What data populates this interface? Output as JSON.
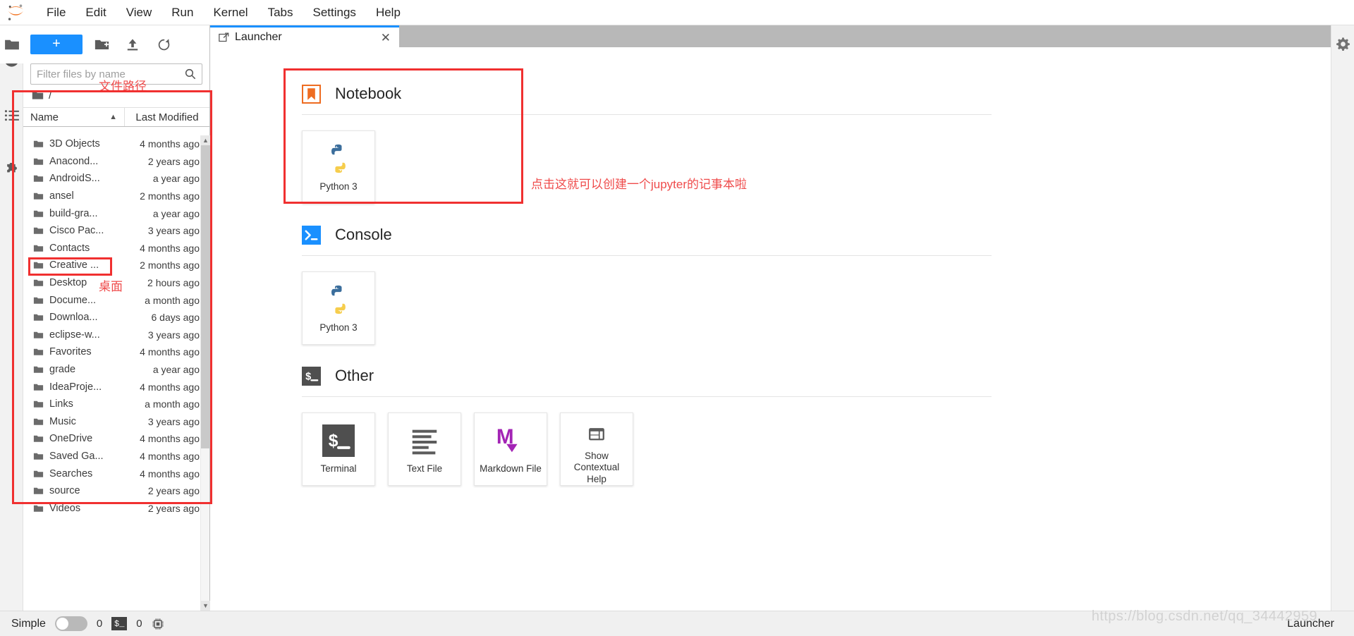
{
  "app": {
    "logo": "jupyter-logo",
    "menu": [
      "File",
      "Edit",
      "View",
      "Run",
      "Kernel",
      "Tabs",
      "Settings",
      "Help"
    ]
  },
  "left_rail": {
    "items": [
      {
        "name": "file-browser-icon",
        "glyph": "folder"
      },
      {
        "name": "running-terminals-icon",
        "glyph": "stop-circle"
      },
      {
        "name": "commands-icon",
        "glyph": "list"
      },
      {
        "name": "extension-manager-icon",
        "glyph": "puzzle"
      }
    ]
  },
  "right_rail": {
    "items": [
      {
        "name": "property-inspector-icon",
        "glyph": "gear"
      }
    ]
  },
  "file_browser": {
    "toolbar": {
      "new_launcher_label": "+",
      "new_folder_label": "new-folder-icon",
      "upload_label": "upload-icon",
      "refresh_label": "refresh-icon"
    },
    "filter": {
      "placeholder": "Filter files by name",
      "value": ""
    },
    "breadcrumb": "/",
    "columns": {
      "name": "Name",
      "last_modified": "Last Modified"
    },
    "sort_indicator": "▲",
    "rows": [
      {
        "name": "3D Objects",
        "modified": "4 months ago"
      },
      {
        "name": "Anacond...",
        "modified": "2 years ago"
      },
      {
        "name": "AndroidS...",
        "modified": "a year ago"
      },
      {
        "name": "ansel",
        "modified": "2 months ago"
      },
      {
        "name": "build-gra...",
        "modified": "a year ago"
      },
      {
        "name": "Cisco Pac...",
        "modified": "3 years ago"
      },
      {
        "name": "Contacts",
        "modified": "4 months ago"
      },
      {
        "name": "Creative ...",
        "modified": "2 months ago"
      },
      {
        "name": "Desktop",
        "modified": "2 hours ago"
      },
      {
        "name": "Docume...",
        "modified": "a month ago"
      },
      {
        "name": "Downloa...",
        "modified": "6 days ago"
      },
      {
        "name": "eclipse-w...",
        "modified": "3 years ago"
      },
      {
        "name": "Favorites",
        "modified": "4 months ago"
      },
      {
        "name": "grade",
        "modified": "a year ago"
      },
      {
        "name": "IdeaProje...",
        "modified": "4 months ago"
      },
      {
        "name": "Links",
        "modified": "a month ago"
      },
      {
        "name": "Music",
        "modified": "3 years ago"
      },
      {
        "name": "OneDrive",
        "modified": "4 months ago"
      },
      {
        "name": "Saved Ga...",
        "modified": "4 months ago"
      },
      {
        "name": "Searches",
        "modified": "4 months ago"
      },
      {
        "name": "source",
        "modified": "2 years ago"
      },
      {
        "name": "Videos",
        "modified": "2 years ago"
      }
    ]
  },
  "main": {
    "tab": {
      "title": "Launcher",
      "close": "✕"
    },
    "launcher": {
      "sections": [
        {
          "id": "notebook",
          "title": "Notebook",
          "icon": "notebook-icon",
          "cards": [
            {
              "label": "Python 3",
              "icon": "python-icon"
            }
          ]
        },
        {
          "id": "console",
          "title": "Console",
          "icon": "console-icon",
          "cards": [
            {
              "label": "Python 3",
              "icon": "python-icon"
            }
          ]
        },
        {
          "id": "other",
          "title": "Other",
          "icon": "terminal-icon",
          "cards": [
            {
              "label": "Terminal",
              "icon": "terminal-icon"
            },
            {
              "label": "Text File",
              "icon": "text-file-icon"
            },
            {
              "label": "Markdown File",
              "icon": "markdown-icon"
            },
            {
              "label": "Show Contextual Help",
              "icon": "contextual-help-icon"
            }
          ]
        }
      ]
    }
  },
  "status_bar": {
    "simple_label": "Simple",
    "toggle_on": false,
    "kernel_count": "0",
    "terminal_glyph": "$_",
    "terminal_count": "0",
    "cpu_icon": "cpu-icon",
    "current_view": "Launcher"
  },
  "annotations": {
    "file_path_label": "文件路径",
    "desktop_label": "桌面",
    "notebook_hint": "点击这就可以创建一个jupyter的记事本啦"
  },
  "watermark": "https://blog.csdn.net/qq_34442959",
  "colors": {
    "accent_blue": "#1a90ff",
    "annotation_red": "#f03030",
    "notebook_orange": "#ee6c21",
    "markdown_purple": "#a324b5",
    "terminal_dark": "#4f4f4f"
  }
}
